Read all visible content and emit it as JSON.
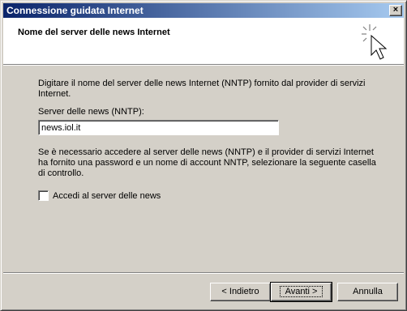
{
  "window": {
    "title": "Connessione guidata Internet",
    "close_glyph": "×"
  },
  "header": {
    "title": "Nome del server delle news Internet",
    "icon": "wizard-cursor-icon"
  },
  "intro": "Digitare il nome del server delle news Internet (NNTP) fornito dal provider di servizi Internet.",
  "server_field": {
    "label": "Server delle news (NNTP):",
    "value": "news.iol.it"
  },
  "auth_note": "Se è necessario accedere al server delle news (NNTP) e il provider di servizi Internet ha fornito una password e un nome di account NNTP, selezionare la seguente casella di controllo.",
  "checkbox": {
    "label": "Accedi al server delle news",
    "checked": false
  },
  "buttons": {
    "back": "< Indietro",
    "next": "Avanti >",
    "cancel": "Annulla"
  },
  "colors": {
    "title_start": "#0a246a",
    "title_end": "#a6caf0",
    "face": "#d4d0c8"
  }
}
